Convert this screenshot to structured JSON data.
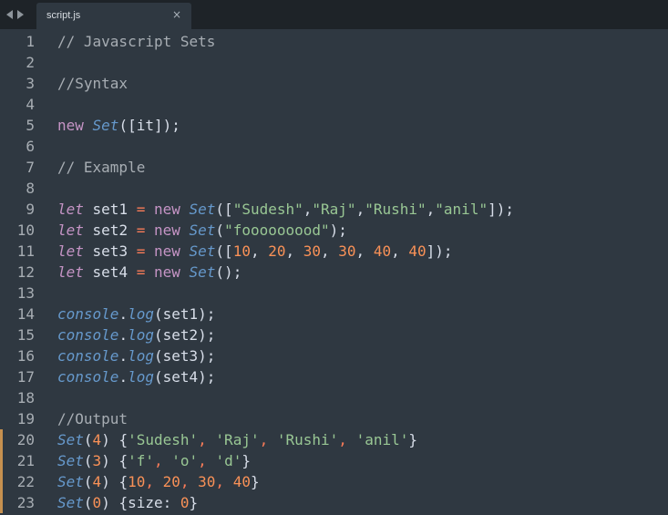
{
  "tab": {
    "title": "script.js",
    "close": "×"
  },
  "colors": {
    "background": "#2f3841",
    "tabbar": "#1e2328",
    "modified_marker": "#c6904f"
  },
  "lines": [
    {
      "n": "1",
      "tokens": [
        {
          "t": "// Javascript Sets",
          "c": "comment"
        }
      ]
    },
    {
      "n": "2",
      "tokens": []
    },
    {
      "n": "3",
      "tokens": [
        {
          "t": "//Syntax",
          "c": "comment"
        }
      ]
    },
    {
      "n": "4",
      "tokens": []
    },
    {
      "n": "5",
      "tokens": [
        {
          "t": "new ",
          "c": "kw"
        },
        {
          "t": "Set",
          "c": "class"
        },
        {
          "t": "([it]);",
          "c": "punc"
        }
      ]
    },
    {
      "n": "6",
      "tokens": []
    },
    {
      "n": "7",
      "tokens": [
        {
          "t": "// Example",
          "c": "comment"
        }
      ]
    },
    {
      "n": "8",
      "tokens": []
    },
    {
      "n": "9",
      "tokens": [
        {
          "t": "let",
          "c": "let"
        },
        {
          "t": " set1 ",
          "c": "ident"
        },
        {
          "t": "=",
          "c": "op"
        },
        {
          "t": " new ",
          "c": "kw"
        },
        {
          "t": "Set",
          "c": "class"
        },
        {
          "t": "([",
          "c": "punc"
        },
        {
          "t": "\"Sudesh\"",
          "c": "str"
        },
        {
          "t": ",",
          "c": "punc"
        },
        {
          "t": "\"Raj\"",
          "c": "str"
        },
        {
          "t": ",",
          "c": "punc"
        },
        {
          "t": "\"Rushi\"",
          "c": "str"
        },
        {
          "t": ",",
          "c": "punc"
        },
        {
          "t": "\"anil\"",
          "c": "str"
        },
        {
          "t": "]);",
          "c": "punc"
        }
      ]
    },
    {
      "n": "10",
      "tokens": [
        {
          "t": "let",
          "c": "let"
        },
        {
          "t": " set2 ",
          "c": "ident"
        },
        {
          "t": "=",
          "c": "op"
        },
        {
          "t": " new ",
          "c": "kw"
        },
        {
          "t": "Set",
          "c": "class"
        },
        {
          "t": "(",
          "c": "punc"
        },
        {
          "t": "\"fooooooood\"",
          "c": "str"
        },
        {
          "t": ");",
          "c": "punc"
        }
      ]
    },
    {
      "n": "11",
      "tokens": [
        {
          "t": "let",
          "c": "let"
        },
        {
          "t": " set3 ",
          "c": "ident"
        },
        {
          "t": "=",
          "c": "op"
        },
        {
          "t": " new ",
          "c": "kw"
        },
        {
          "t": "Set",
          "c": "class"
        },
        {
          "t": "([",
          "c": "punc"
        },
        {
          "t": "10",
          "c": "num"
        },
        {
          "t": ", ",
          "c": "punc"
        },
        {
          "t": "20",
          "c": "num"
        },
        {
          "t": ", ",
          "c": "punc"
        },
        {
          "t": "30",
          "c": "num"
        },
        {
          "t": ", ",
          "c": "punc"
        },
        {
          "t": "30",
          "c": "num"
        },
        {
          "t": ", ",
          "c": "punc"
        },
        {
          "t": "40",
          "c": "num"
        },
        {
          "t": ", ",
          "c": "punc"
        },
        {
          "t": "40",
          "c": "num"
        },
        {
          "t": "]);",
          "c": "punc"
        }
      ]
    },
    {
      "n": "12",
      "tokens": [
        {
          "t": "let",
          "c": "let"
        },
        {
          "t": " set4 ",
          "c": "ident"
        },
        {
          "t": "=",
          "c": "op"
        },
        {
          "t": " new ",
          "c": "kw"
        },
        {
          "t": "Set",
          "c": "class"
        },
        {
          "t": "();",
          "c": "punc"
        }
      ]
    },
    {
      "n": "13",
      "tokens": []
    },
    {
      "n": "14",
      "tokens": [
        {
          "t": "console",
          "c": "console"
        },
        {
          "t": ".",
          "c": "punc"
        },
        {
          "t": "log",
          "c": "method"
        },
        {
          "t": "(set1);",
          "c": "punc"
        }
      ]
    },
    {
      "n": "15",
      "tokens": [
        {
          "t": "console",
          "c": "console"
        },
        {
          "t": ".",
          "c": "punc"
        },
        {
          "t": "log",
          "c": "method"
        },
        {
          "t": "(set2);",
          "c": "punc"
        }
      ]
    },
    {
      "n": "16",
      "tokens": [
        {
          "t": "console",
          "c": "console"
        },
        {
          "t": ".",
          "c": "punc"
        },
        {
          "t": "log",
          "c": "method"
        },
        {
          "t": "(set3);",
          "c": "punc"
        }
      ]
    },
    {
      "n": "17",
      "tokens": [
        {
          "t": "console",
          "c": "console"
        },
        {
          "t": ".",
          "c": "punc"
        },
        {
          "t": "log",
          "c": "method"
        },
        {
          "t": "(set4);",
          "c": "punc"
        }
      ]
    },
    {
      "n": "18",
      "tokens": []
    },
    {
      "n": "19",
      "tokens": [
        {
          "t": "//Output",
          "c": "comment"
        }
      ]
    },
    {
      "n": "20",
      "modified": true,
      "tokens": [
        {
          "t": "Set",
          "c": "class"
        },
        {
          "t": "(",
          "c": "punc"
        },
        {
          "t": "4",
          "c": "num"
        },
        {
          "t": ") {",
          "c": "punc"
        },
        {
          "t": "'Sudesh'",
          "c": "str"
        },
        {
          "t": ", ",
          "c": "op"
        },
        {
          "t": "'Raj'",
          "c": "str"
        },
        {
          "t": ", ",
          "c": "op"
        },
        {
          "t": "'Rushi'",
          "c": "str"
        },
        {
          "t": ", ",
          "c": "op"
        },
        {
          "t": "'anil'",
          "c": "str"
        },
        {
          "t": "}",
          "c": "punc"
        }
      ]
    },
    {
      "n": "21",
      "modified": true,
      "tokens": [
        {
          "t": "Set",
          "c": "class"
        },
        {
          "t": "(",
          "c": "punc"
        },
        {
          "t": "3",
          "c": "num"
        },
        {
          "t": ") {",
          "c": "punc"
        },
        {
          "t": "'f'",
          "c": "str"
        },
        {
          "t": ", ",
          "c": "op"
        },
        {
          "t": "'o'",
          "c": "str"
        },
        {
          "t": ", ",
          "c": "op"
        },
        {
          "t": "'d'",
          "c": "str"
        },
        {
          "t": "}",
          "c": "punc"
        }
      ]
    },
    {
      "n": "22",
      "modified": true,
      "tokens": [
        {
          "t": "Set",
          "c": "class"
        },
        {
          "t": "(",
          "c": "punc"
        },
        {
          "t": "4",
          "c": "num"
        },
        {
          "t": ") {",
          "c": "punc"
        },
        {
          "t": "10",
          "c": "num"
        },
        {
          "t": ", ",
          "c": "op"
        },
        {
          "t": "20",
          "c": "num"
        },
        {
          "t": ", ",
          "c": "op"
        },
        {
          "t": "30",
          "c": "num"
        },
        {
          "t": ", ",
          "c": "op"
        },
        {
          "t": "40",
          "c": "num"
        },
        {
          "t": "}",
          "c": "punc"
        }
      ]
    },
    {
      "n": "23",
      "modified": true,
      "tokens": [
        {
          "t": "Set",
          "c": "class"
        },
        {
          "t": "(",
          "c": "punc"
        },
        {
          "t": "0",
          "c": "num"
        },
        {
          "t": ") {size: ",
          "c": "punc"
        },
        {
          "t": "0",
          "c": "num"
        },
        {
          "t": "}",
          "c": "punc"
        }
      ]
    }
  ]
}
